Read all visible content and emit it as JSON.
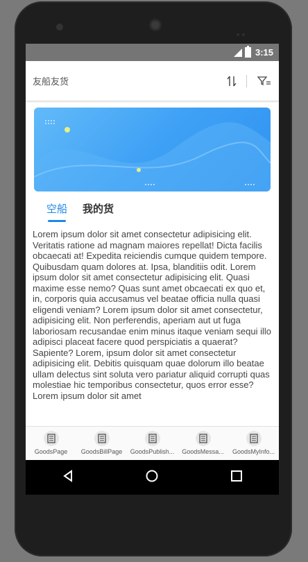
{
  "status_bar": {
    "time": "3:15"
  },
  "app_bar": {
    "title": "友船友货",
    "sort_icon": "sort-arrows-icon",
    "filter_icon": "filter-icon"
  },
  "tabs": [
    {
      "label": "空船",
      "active": true
    },
    {
      "label": "我的货",
      "active": false
    }
  ],
  "content": {
    "text": "Lorem ipsum dolor sit amet consectetur adipisicing elit. Veritatis ratione ad magnam maiores repellat! Dicta facilis obcaecati at! Expedita reiciendis cumque quidem tempore. Quibusdam quam dolores at. Ipsa, blanditiis odit. Lorem ipsum dolor sit amet consectetur adipisicing elit. Quasi maxime esse nemo? Quas sunt amet obcaecati ex quo et, in, corporis quia accusamus vel beatae officia nulla quasi eligendi veniam? Lorem ipsum dolor sit amet consectetur, adipisicing elit. Non perferendis, aperiam aut ut fuga laboriosam recusandae enim minus itaque veniam sequi illo adipisci placeat facere quod perspiciatis a quaerat? Sapiente? Lorem, ipsum dolor sit amet consectetur adipisicing elit. Debitis quisquam quae dolorum illo beatae ullam delectus sint soluta vero pariatur aliquid corrupti quas molestiae hic temporibus consectetur, quos error esse? Lorem ipsum dolor sit amet"
  },
  "bottom_nav": [
    {
      "label": "GoodsPage",
      "icon": "document-list-icon"
    },
    {
      "label": "GoodsBillPage",
      "icon": "document-list-icon"
    },
    {
      "label": "GoodsPublish...",
      "icon": "document-list-icon"
    },
    {
      "label": "GoodsMessa...",
      "icon": "document-list-icon"
    },
    {
      "label": "GoodsMyInfo...",
      "icon": "document-list-icon"
    }
  ],
  "colors": {
    "accent": "#1e88e5",
    "status_bar": "#757575",
    "banner_start": "#62baf8",
    "banner_end": "#2f92f0"
  }
}
